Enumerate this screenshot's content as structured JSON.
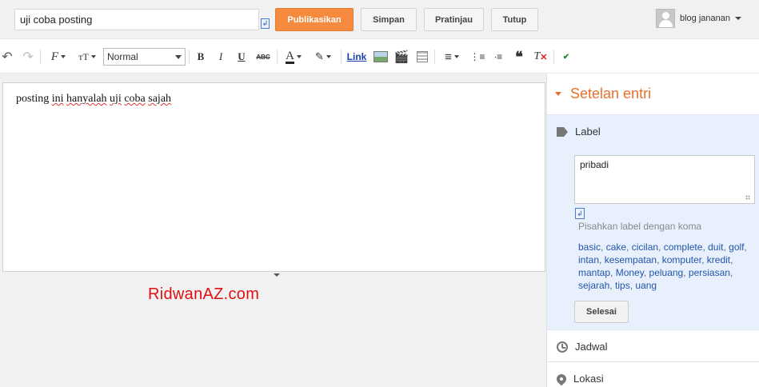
{
  "post": {
    "title_value": "uji coba posting",
    "body_text_words": [
      "posting ",
      "ini",
      " ",
      "hanyalah",
      " ",
      "uji",
      " ",
      "coba",
      " ",
      "sajah"
    ]
  },
  "actions": {
    "publish": "Publikasikan",
    "save": "Simpan",
    "preview": "Pratinjau",
    "close": "Tutup"
  },
  "user": {
    "name": "blog jananan"
  },
  "toolbar": {
    "format_value": "Normal",
    "link_label": "Link"
  },
  "watermark": "RidwanAZ.com",
  "sidebar": {
    "title": "Setelan entri",
    "label_section": {
      "title": "Label",
      "value": "pribadi",
      "hint": "Pisahkan label dengan koma",
      "suggestions": [
        "basic",
        "cake",
        "cicilan",
        "complete",
        "duit",
        "golf",
        "intan",
        "kesempatan",
        "komputer",
        "kredit",
        "mantap",
        "Money",
        "peluang",
        "persiasan",
        "sejarah",
        "tips",
        "uang"
      ],
      "done": "Selesai"
    },
    "schedule": "Jadwal",
    "location": "Lokasi"
  },
  "colors": {
    "accent": "#f68a3e",
    "sidebar_title": "#e8702a",
    "label_panel": "#e8f0fe",
    "link": "#2255aa",
    "watermark": "#dd1111"
  }
}
